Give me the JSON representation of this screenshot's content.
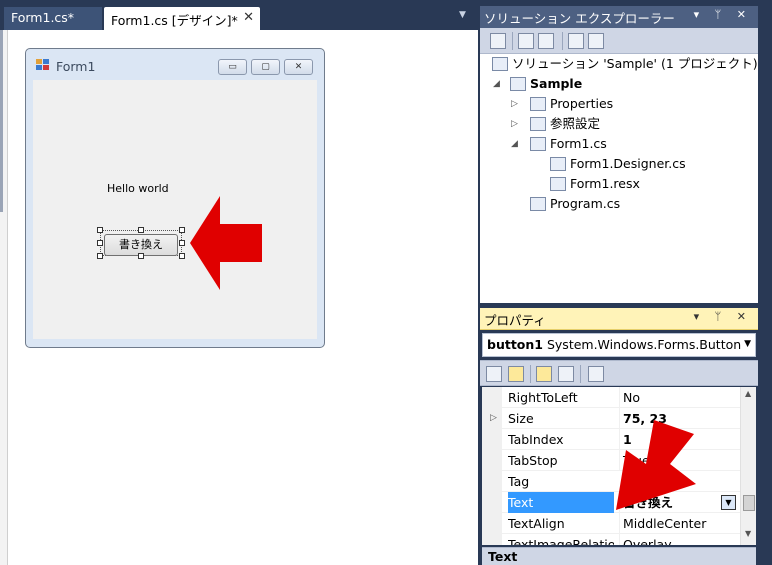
{
  "document_tabs": [
    {
      "label": "Form1.cs*"
    },
    {
      "label": "Form1.cs [デザイン]*",
      "close_glyph": "✕"
    }
  ],
  "tabstrip_dropdown_glyph": "▼",
  "form": {
    "title": "Form1",
    "min_glyph": "▭",
    "max_glyph": "▢",
    "close_glyph": "✕",
    "label_text": "Hello world",
    "button_text": "書き換え"
  },
  "solution_explorer": {
    "title": "ソリューション エクスプローラー",
    "header_controls": "▾ ᛘ ✕",
    "items": [
      {
        "label": "ソリューション 'Sample' (1 プロジェクト)",
        "bold": false
      },
      {
        "label": "Sample",
        "bold": true
      },
      {
        "label": "Properties"
      },
      {
        "label": "参照設定"
      },
      {
        "label": "Form1.cs"
      },
      {
        "label": "Form1.Designer.cs"
      },
      {
        "label": "Form1.resx"
      },
      {
        "label": "Program.cs"
      }
    ]
  },
  "properties": {
    "title": "プロパティ",
    "header_controls": "▾ ᛘ ✕",
    "object_name": "button1",
    "object_type": "System.Windows.Forms.Button",
    "rows": [
      {
        "name": "RightToLeft",
        "value": "No"
      },
      {
        "name": "Size",
        "value": "75, 23"
      },
      {
        "name": "TabIndex",
        "value": "1"
      },
      {
        "name": "TabStop",
        "value": "True"
      },
      {
        "name": "Tag",
        "value": ""
      },
      {
        "name": "Text",
        "value": "書き換え"
      },
      {
        "name": "TextAlign",
        "value": "MiddleCenter"
      },
      {
        "name": "TextImageRelation",
        "value": "Overlay"
      }
    ],
    "description_title": "Text"
  },
  "colors": {
    "highlight_arrow": "#e00000",
    "selection": "#3399ff",
    "tool_header": "#4d6082",
    "active_header": "#fff3b8"
  }
}
